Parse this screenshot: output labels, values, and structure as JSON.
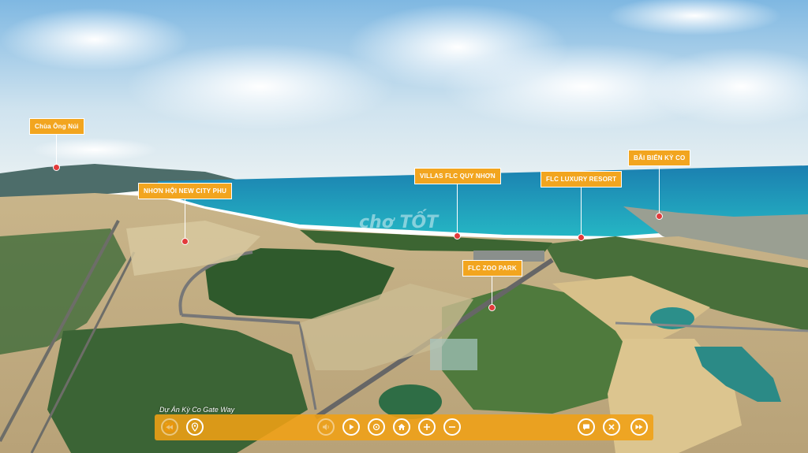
{
  "viewer": {
    "project_title": "Dự Án Kỳ Co Gate Way",
    "watermark": "chợ TỐT"
  },
  "pins": [
    {
      "id": "chua-ong-nui",
      "label": "Chùa Ông Núi"
    },
    {
      "id": "nhon-hoi",
      "label": "NHƠN HỘI NEW CITY PHU"
    },
    {
      "id": "villas-flc",
      "label": "VILLAS FLC QUY NHƠN"
    },
    {
      "id": "flc-luxury",
      "label": "FLC LUXURY RESORT"
    },
    {
      "id": "bai-bien-ky-co",
      "label": "BÃI BIỂN KỲ CO"
    },
    {
      "id": "flc-zoo",
      "label": "FLC ZOO PARK"
    }
  ],
  "toolbar": {
    "buttons": [
      {
        "icon": "rewind-icon"
      },
      {
        "icon": "location-icon"
      },
      {
        "icon": "volume-icon"
      },
      {
        "icon": "play-icon"
      },
      {
        "icon": "rotate-icon"
      },
      {
        "icon": "home-icon"
      },
      {
        "icon": "zoom-in-icon"
      },
      {
        "icon": "zoom-out-icon"
      },
      {
        "icon": "chat-icon"
      },
      {
        "icon": "close-icon"
      },
      {
        "icon": "fast-forward-icon"
      }
    ]
  },
  "colors": {
    "accent": "#f2a51f",
    "pin_dot": "#e23b3b",
    "sea": "#1aa0b8",
    "sky": "#9ccbe8"
  }
}
